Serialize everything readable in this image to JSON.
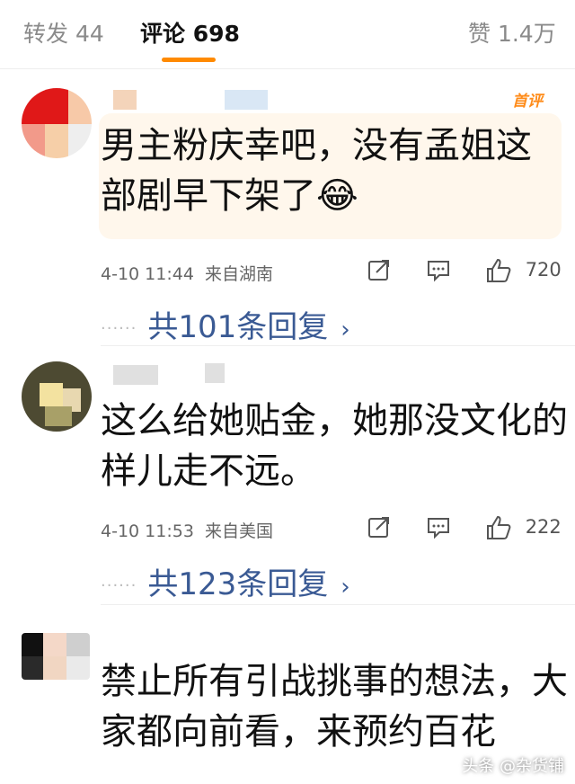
{
  "tabs": {
    "repost": "转发 44",
    "comments": "评论 698",
    "likes": "赞 1.4万"
  },
  "comments": [
    {
      "text": "男主粉庆幸吧，没有孟姐这部剧早下架了😂",
      "badge": "首评",
      "time": "4-10 11:44",
      "location": "来自湖南",
      "likes": "720",
      "replies": "共101条回复"
    },
    {
      "text": "这么给她贴金，她那没文化的样儿走不远。",
      "time": "4-10 11:53",
      "location": "来自美国",
      "likes": "222",
      "replies": "共123条回复"
    },
    {
      "text": "禁止所有引战挑事的想法，大家都向前看，来预约百花"
    }
  ],
  "watermark": "头条 @杂货铺",
  "colors": {
    "accent": "#ff8a00",
    "reply_link": "#3a5a94",
    "first_bubble": "#fff7ec"
  },
  "icons": [
    "repost-icon",
    "comment-icon",
    "thumbs-up-icon",
    "chevron-right-icon"
  ]
}
